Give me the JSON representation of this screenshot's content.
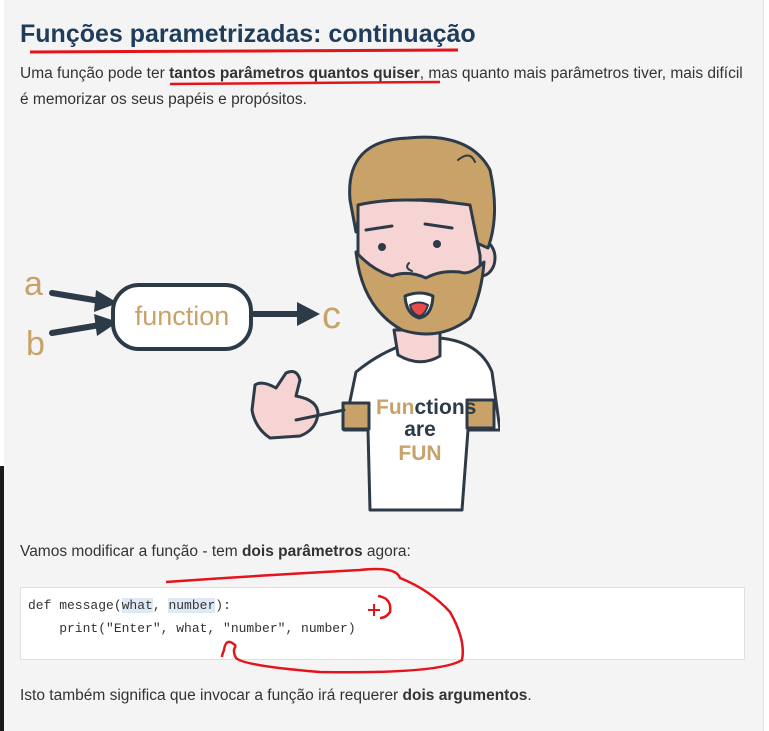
{
  "heading": {
    "title": "Funções parametrizadas: continuação"
  },
  "intro": {
    "before": "Uma função pode ter ",
    "bold": "tantos parâmetros quantos quiser",
    "after": ", mas quanto mais parâmetros tiver, mais difícil é memorizar os seus papéis e propósitos."
  },
  "illustration": {
    "input_a": "a",
    "input_b": "b",
    "function_label": "function",
    "output_c": "c",
    "shirt_line1_accent": "Fun",
    "shirt_line1_rest": "ctions",
    "shirt_line2": "are",
    "shirt_line3": "FUN"
  },
  "modify": {
    "before": "Vamos modificar a função - tem ",
    "bold": "dois parâmetros",
    "after": " agora:"
  },
  "code": {
    "l1_a": "def message(",
    "l1_p1": "what",
    "l1_b": ", ",
    "l1_p2": "number",
    "l1_c": "):",
    "l2": "    print(\"Enter\", what, \"number\", number)"
  },
  "closing": {
    "before": "Isto também significa que invocar a função irá requerer ",
    "bold": "dois argumentos",
    "after": "."
  },
  "colors": {
    "title": "#1f3d5a",
    "accent_tan": "#c9a26a",
    "annotation_red": "#e3141b",
    "panel_bg": "#f4f4f4",
    "skin_pink": "#f6d4d4"
  }
}
